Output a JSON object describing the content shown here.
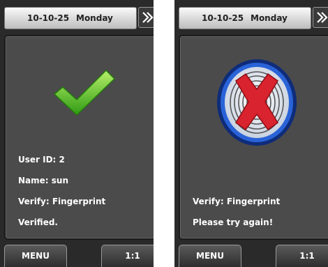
{
  "screens": [
    {
      "header": {
        "date": "10-10-25",
        "day": "Monday"
      },
      "result_icon": "checkmark-icon",
      "info": {
        "user_id": "User ID: 2",
        "name": "Name: sun",
        "verify": "Verify: Fingerprint",
        "status": "Verified."
      },
      "buttons": {
        "menu": "MENU",
        "mode": "1:1"
      }
    },
    {
      "header": {
        "date": "10-10-25",
        "day": "Monday"
      },
      "result_icon": "fingerprint-fail-icon",
      "info": {
        "verify": "Verify: Fingerprint",
        "status": "Please try again!"
      },
      "buttons": {
        "menu": "MENU",
        "mode": "1:1"
      }
    }
  ],
  "colors": {
    "success": "#4cbb1c",
    "error": "#d9232e",
    "ring": "#1a4fbf"
  }
}
